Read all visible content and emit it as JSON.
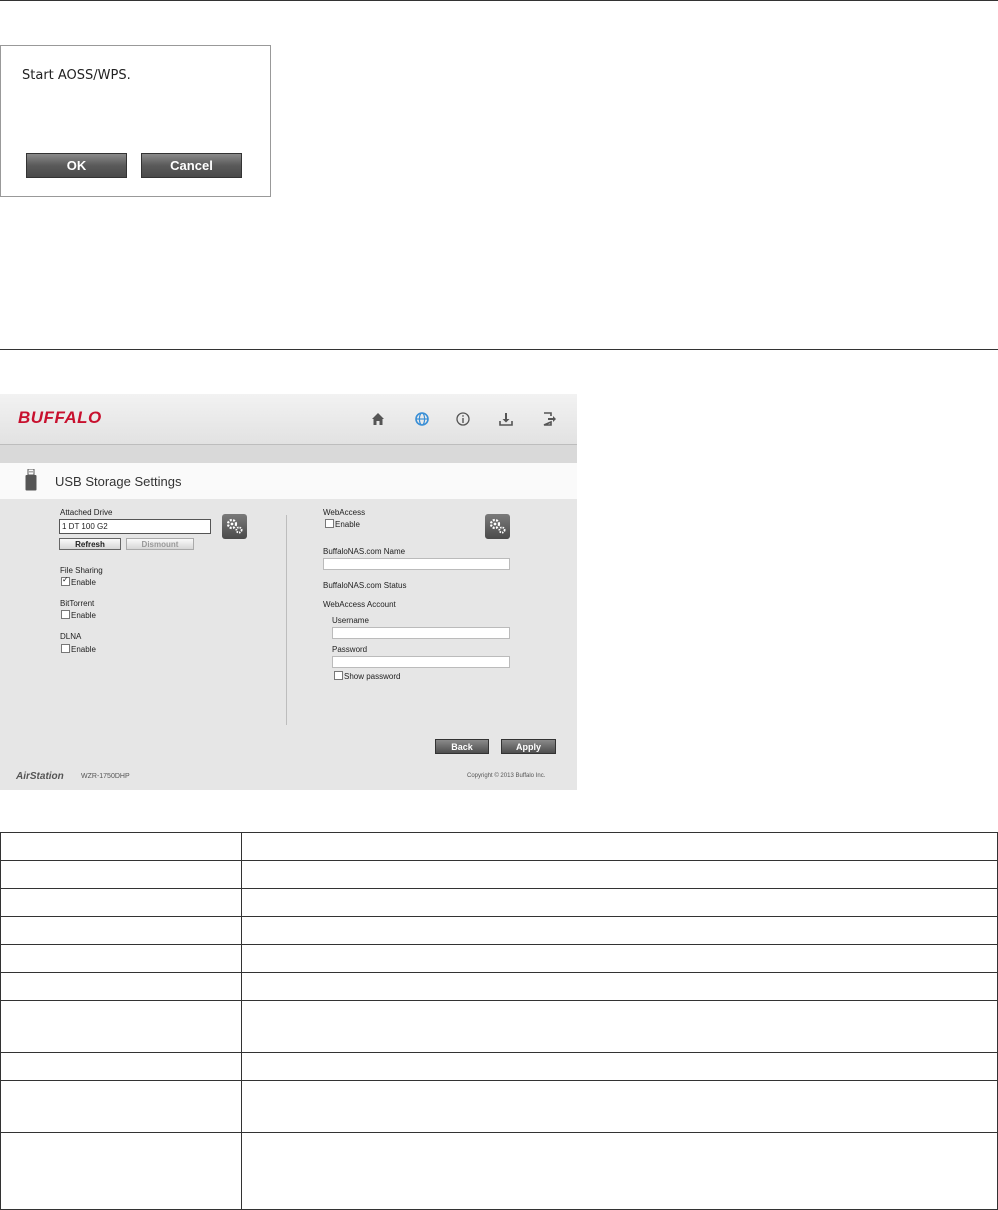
{
  "dialog": {
    "message": "Start AOSS/WPS.",
    "ok_label": "OK",
    "cancel_label": "Cancel"
  },
  "router": {
    "brand": "BUFFALO",
    "nav_icons": [
      "home-icon",
      "globe-icon",
      "info-icon",
      "download-icon",
      "logout-icon"
    ],
    "page_title": "USB Storage Settings",
    "left": {
      "attached_drive_label": "Attached Drive",
      "attached_drive_value": "1 DT 100 G2",
      "refresh_label": "Refresh",
      "dismount_label": "Dismount",
      "file_sharing_label": "File Sharing",
      "file_sharing_enable": "Enable",
      "file_sharing_checked": true,
      "bittorrent_label": "BitTorrent",
      "bittorrent_enable": "Enable",
      "bittorrent_checked": false,
      "dlna_label": "DLNA",
      "dlna_enable": "Enable",
      "dlna_checked": false
    },
    "right": {
      "webaccess_label": "WebAccess",
      "webaccess_enable": "Enable",
      "webaccess_checked": false,
      "buffalonas_name_label": "BuffaloNAS.com Name",
      "buffalonas_name_value": "",
      "buffalonas_status_label": "BuffaloNAS.com Status",
      "webaccess_account_label": "WebAccess Account",
      "username_label": "Username",
      "username_value": "",
      "password_label": "Password",
      "password_value": "",
      "show_password_label": "Show password",
      "show_password_checked": false
    },
    "back_label": "Back",
    "apply_label": "Apply",
    "footer_brand": "AirStation",
    "footer_model": "WZR-1750DHP",
    "footer_copyright": "Copyright © 2013 Buffalo Inc."
  },
  "table": {
    "rows": 10
  },
  "colors": {
    "brand_red": "#c8102e",
    "nav_active_blue": "#3a8fd6",
    "button_dark": "#5a5a5a"
  }
}
